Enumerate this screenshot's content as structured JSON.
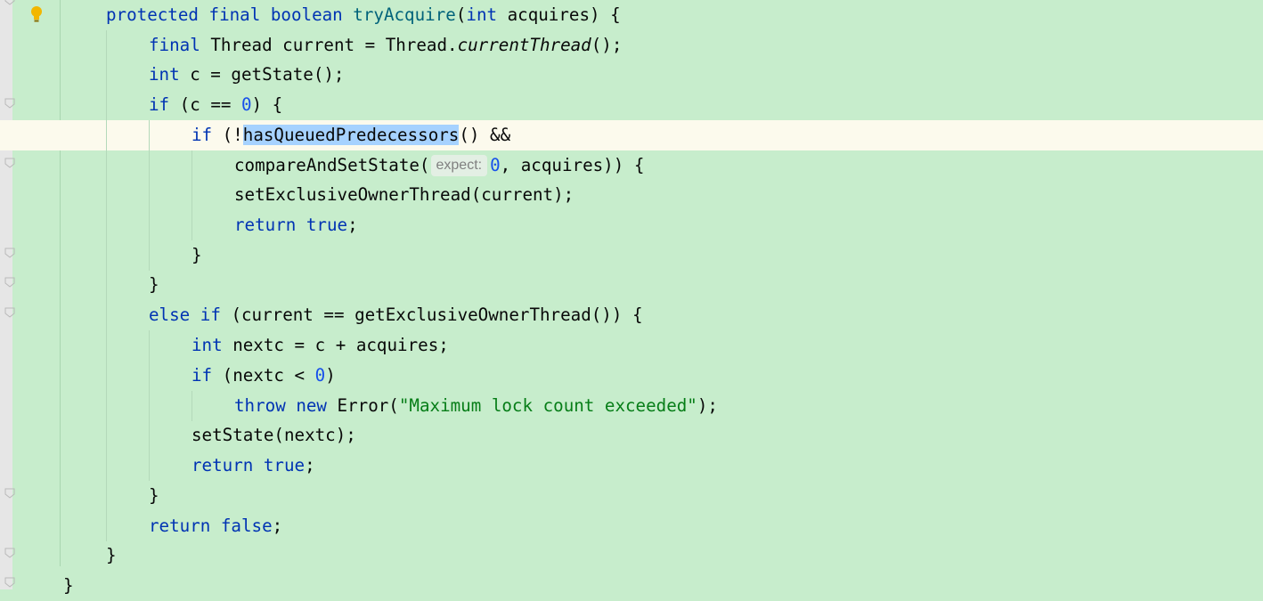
{
  "editor": {
    "lines": [
      [
        "<span class='kw'>protected</span> <span class='kw'>final</span> <span class='kw'>boolean</span> <span class='fn'>tryAcquire</span>(<span class='kw'>int</span> acquires) {"
      ],
      [
        "<span class='kw'>final</span> Thread current = Thread.<span class='it'>currentThread</span>();"
      ],
      [
        "<span class='kw'>int</span> c = getState();"
      ],
      [
        "<span class='kw'>if</span> (c == <span class='num'>0</span>) {"
      ],
      [
        "<span class='kw'>if</span> (!<span class='sel'>hasQueuedPredecessors</span>() &amp;&amp;"
      ],
      [
        "compareAndSetState(<span class='hint'>expect:</span><span class='num'>0</span>, acquires)) {"
      ],
      [
        "setExclusiveOwnerThread(current);"
      ],
      [
        "<span class='kw'>return</span> <span class='kw'>true</span>;"
      ],
      [
        "}"
      ],
      [
        "}"
      ],
      [
        "<span class='kw'>else</span> <span class='kw'>if</span> (current == getExclusiveOwnerThread()) {"
      ],
      [
        "<span class='kw'>int</span> nextc = c + acquires;"
      ],
      [
        "<span class='kw'>if</span> (nextc &lt; <span class='num'>0</span>)"
      ],
      [
        "<span class='kw'>throw</span> <span class='kw'>new</span> Error(<span class='str'>\"Maximum lock count exceeded\"</span>);"
      ],
      [
        "setState(nextc);"
      ],
      [
        "<span class='kw'>return</span> <span class='kw'>true</span>;"
      ],
      [
        "}"
      ],
      [
        "<span class='kw'>return</span> <span class='kw'>false</span>;"
      ],
      [
        "}"
      ],
      [
        "}"
      ]
    ],
    "current_line_index": 4,
    "gutter_icons": [
      "lightbulb-icon"
    ],
    "colors": {
      "background": "#c7edcc",
      "current_line": "#fcfaed",
      "keyword": "#0033b3",
      "method_decl": "#00627a",
      "number": "#1750eb",
      "string": "#067d17",
      "selection": "#a6d2ff",
      "gutter": "#e6e6e6"
    }
  }
}
